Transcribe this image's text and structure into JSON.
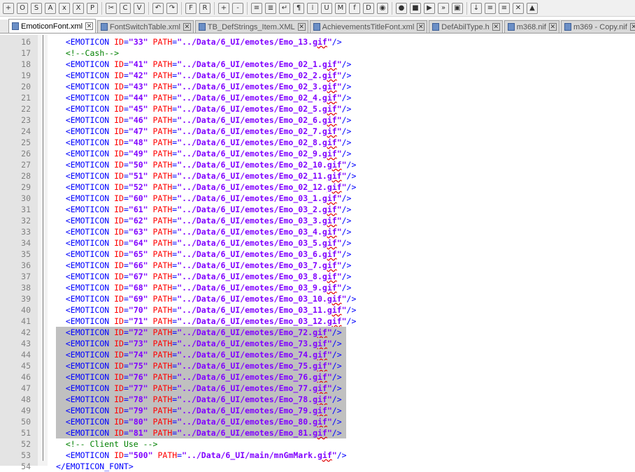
{
  "toolbar": {
    "buttons": [
      {
        "name": "new-file-icon",
        "glyph": "+"
      },
      {
        "name": "open-file-icon",
        "glyph": "O"
      },
      {
        "name": "save-icon",
        "glyph": "S"
      },
      {
        "name": "save-all-icon",
        "glyph": "A"
      },
      {
        "name": "close-icon",
        "glyph": "x"
      },
      {
        "name": "close-all-icon",
        "glyph": "X"
      },
      {
        "name": "print-icon",
        "glyph": "P"
      },
      {
        "name": "cut-icon",
        "glyph": "✂"
      },
      {
        "name": "copy-icon",
        "glyph": "C"
      },
      {
        "name": "paste-icon",
        "glyph": "V"
      },
      {
        "name": "undo-icon",
        "glyph": "↶"
      },
      {
        "name": "redo-icon",
        "glyph": "↷"
      },
      {
        "name": "find-icon",
        "glyph": "F"
      },
      {
        "name": "replace-icon",
        "glyph": "R"
      },
      {
        "name": "zoom-in-icon",
        "glyph": "+"
      },
      {
        "name": "zoom-out-icon",
        "glyph": "-"
      },
      {
        "name": "sync-v-scroll-icon",
        "glyph": "≡"
      },
      {
        "name": "sync-h-scroll-icon",
        "glyph": "≣"
      },
      {
        "name": "word-wrap-icon",
        "glyph": "↵"
      },
      {
        "name": "show-all-chars-icon",
        "glyph": "¶"
      },
      {
        "name": "indent-guide-icon",
        "glyph": "⁞"
      },
      {
        "name": "user-lang-icon",
        "glyph": "U"
      },
      {
        "name": "doc-map-icon",
        "glyph": "M"
      },
      {
        "name": "function-list-icon",
        "glyph": "f"
      },
      {
        "name": "folder-workspace-icon",
        "glyph": "D"
      },
      {
        "name": "monitoring-icon",
        "glyph": "◉"
      },
      {
        "name": "record-macro-icon",
        "glyph": "●"
      },
      {
        "name": "stop-macro-icon",
        "glyph": "■"
      },
      {
        "name": "play-macro-icon",
        "glyph": "▶"
      },
      {
        "name": "run-macro-multiple-icon",
        "glyph": "»"
      },
      {
        "name": "save-macro-icon",
        "glyph": "▣"
      },
      {
        "name": "compare-icon",
        "glyph": "↓"
      },
      {
        "name": "compare-next-icon",
        "glyph": "≡"
      },
      {
        "name": "compare-prev-icon",
        "glyph": "≡"
      },
      {
        "name": "close-compare-icon",
        "glyph": "✕"
      },
      {
        "name": "up-arrow-icon",
        "glyph": "▲"
      }
    ]
  },
  "tabs": [
    {
      "label": "EmoticonFont.xml",
      "active": true
    },
    {
      "label": "FontSwitchTable.xml",
      "active": false
    },
    {
      "label": "TB_DefStrings_Item.XML",
      "active": false
    },
    {
      "label": "AchievementsTitleFont.xml",
      "active": false
    },
    {
      "label": "DefAbilType.h",
      "active": false
    },
    {
      "label": "m368.nif",
      "active": false
    },
    {
      "label": "m369 - Copy.nif",
      "active": false
    }
  ],
  "editor": {
    "selection_start_line": 42,
    "selection_end_line": 51,
    "lines": [
      {
        "n": "16",
        "id": "33",
        "path": "../Data/6_UI/emotes/Emo_13.gif"
      },
      {
        "n": "17",
        "comment": "<!--Cash-->"
      },
      {
        "n": "18",
        "id": "41",
        "path": "../Data/6_UI/emotes/Emo_02_1.gif"
      },
      {
        "n": "19",
        "id": "42",
        "path": "../Data/6_UI/emotes/Emo_02_2.gif"
      },
      {
        "n": "20",
        "id": "43",
        "path": "../Data/6_UI/emotes/Emo_02_3.gif"
      },
      {
        "n": "21",
        "id": "44",
        "path": "../Data/6_UI/emotes/Emo_02_4.gif"
      },
      {
        "n": "22",
        "id": "45",
        "path": "../Data/6_UI/emotes/Emo_02_5.gif"
      },
      {
        "n": "23",
        "id": "46",
        "path": "../Data/6_UI/emotes/Emo_02_6.gif"
      },
      {
        "n": "24",
        "id": "47",
        "path": "../Data/6_UI/emotes/Emo_02_7.gif"
      },
      {
        "n": "25",
        "id": "48",
        "path": "../Data/6_UI/emotes/Emo_02_8.gif"
      },
      {
        "n": "26",
        "id": "49",
        "path": "../Data/6_UI/emotes/Emo_02_9.gif"
      },
      {
        "n": "27",
        "id": "50",
        "path": "../Data/6_UI/emotes/Emo_02_10.gif"
      },
      {
        "n": "28",
        "id": "51",
        "path": "../Data/6_UI/emotes/Emo_02_11.gif"
      },
      {
        "n": "29",
        "id": "52",
        "path": "../Data/6_UI/emotes/Emo_02_12.gif"
      },
      {
        "n": "30",
        "id": "60",
        "path": "../Data/6_UI/emotes/Emo_03_1.gif"
      },
      {
        "n": "31",
        "id": "61",
        "path": "../Data/6_UI/emotes/Emo_03_2.gif"
      },
      {
        "n": "32",
        "id": "62",
        "path": "../Data/6_UI/emotes/Emo_03_3.gif"
      },
      {
        "n": "33",
        "id": "63",
        "path": "../Data/6_UI/emotes/Emo_03_4.gif"
      },
      {
        "n": "34",
        "id": "64",
        "path": "../Data/6_UI/emotes/Emo_03_5.gif"
      },
      {
        "n": "35",
        "id": "65",
        "path": "../Data/6_UI/emotes/Emo_03_6.gif"
      },
      {
        "n": "36",
        "id": "66",
        "path": "../Data/6_UI/emotes/Emo_03_7.gif"
      },
      {
        "n": "37",
        "id": "67",
        "path": "../Data/6_UI/emotes/Emo_03_8.gif"
      },
      {
        "n": "38",
        "id": "68",
        "path": "../Data/6_UI/emotes/Emo_03_9.gif"
      },
      {
        "n": "39",
        "id": "69",
        "path": "../Data/6_UI/emotes/Emo_03_10.gif"
      },
      {
        "n": "40",
        "id": "70",
        "path": "../Data/6_UI/emotes/Emo_03_11.gif"
      },
      {
        "n": "41",
        "id": "71",
        "path": "../Data/6_UI/emotes/Emo_03_12.gif"
      },
      {
        "n": "42",
        "id": "72",
        "path": "../Data/6_UI/emotes/Emo_72.gif"
      },
      {
        "n": "43",
        "id": "73",
        "path": "../Data/6_UI/emotes/Emo_73.gif"
      },
      {
        "n": "44",
        "id": "74",
        "path": "../Data/6_UI/emotes/Emo_74.gif"
      },
      {
        "n": "45",
        "id": "75",
        "path": "../Data/6_UI/emotes/Emo_75.gif"
      },
      {
        "n": "46",
        "id": "76",
        "path": "../Data/6_UI/emotes/Emo_76.gif"
      },
      {
        "n": "47",
        "id": "77",
        "path": "../Data/6_UI/emotes/Emo_77.gif"
      },
      {
        "n": "48",
        "id": "78",
        "path": "../Data/6_UI/emotes/Emo_78.gif"
      },
      {
        "n": "49",
        "id": "79",
        "path": "../Data/6_UI/emotes/Emo_79.gif"
      },
      {
        "n": "50",
        "id": "80",
        "path": "../Data/6_UI/emotes/Emo_80.gif"
      },
      {
        "n": "51",
        "id": "81",
        "path": "../Data/6_UI/emotes/Emo_81.gif"
      },
      {
        "n": "52",
        "comment": "<!-- Client Use -->"
      },
      {
        "n": "53",
        "id": "500",
        "path": "../Data/6_UI/main/mnGmMark.gif"
      },
      {
        "n": "54",
        "close": "</EMOTICON_FONT>"
      }
    ]
  },
  "colors": {
    "tag": "#0000ff",
    "attribute": "#ff0000",
    "value": "#8000ff",
    "comment": "#008000",
    "selection": "#c0c0c0"
  }
}
